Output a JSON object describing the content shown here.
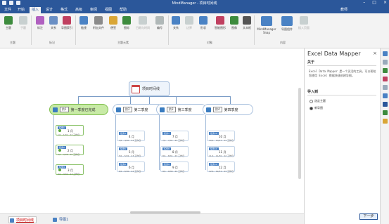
{
  "window": {
    "title": "MindManager - 项目时间线",
    "account": "教师",
    "controls": [
      "–",
      "□",
      "×"
    ]
  },
  "menu": {
    "tabs": [
      "文件",
      "开始",
      "插入",
      "设计",
      "格式",
      "高级",
      "审阅",
      "视图",
      "帮助"
    ],
    "active_index": 2
  },
  "ribbon": {
    "buttons": [
      {
        "label": "主题",
        "icon": "topic-icon",
        "color": "#3d8b3d"
      },
      {
        "label": "子题",
        "icon": "subtopic-icon",
        "color": "#9aa",
        "dim": true
      },
      {
        "label": "标注",
        "icon": "callout-icon",
        "color": "#b060c0"
      },
      {
        "label": "关系",
        "icon": "relationship-icon",
        "color": "#6a8fc4"
      },
      {
        "label": "导图索引",
        "icon": "index-icon",
        "color": "#c04060"
      },
      {
        "label": "链接",
        "icon": "link-icon",
        "color": "#4a82c4"
      },
      {
        "label": "附加文件",
        "icon": "attach-icon",
        "color": "#8a8a8a"
      },
      {
        "label": "便签",
        "icon": "notes-icon",
        "color": "#d9a636"
      },
      {
        "label": "图标",
        "icon": "icons-icon",
        "color": "#3d8b3d"
      },
      {
        "label": "日期与时间",
        "icon": "date-icon",
        "color": "#9aa",
        "dim": true
      },
      {
        "label": "编号",
        "icon": "numbering-icon",
        "color": "#9aa"
      },
      {
        "label": "关系",
        "icon": "boundary-icon",
        "color": "#4a82c4"
      },
      {
        "label": "边界",
        "icon": "border-icon",
        "color": "#9aa",
        "dim": true
      },
      {
        "label": "形状",
        "icon": "shape-icon",
        "color": "#4a82c4"
      },
      {
        "label": "智能图形",
        "icon": "smartshape-icon",
        "color": "#c04060"
      },
      {
        "label": "图像",
        "icon": "image-icon",
        "color": "#3d8b3d"
      },
      {
        "label": "文本框",
        "icon": "textbox-icon",
        "color": "#555"
      },
      {
        "label": "MindManager Snap",
        "icon": "snap-icon",
        "color": "#4a82c4"
      },
      {
        "label": "导图组件",
        "icon": "component-icon",
        "color": "#4a82c4"
      },
      {
        "label": "插入页面",
        "icon": "page-icon",
        "color": "#9aa",
        "dim": true
      }
    ],
    "groups": [
      "主题",
      "标记",
      "主题元素",
      "对象",
      "内容"
    ]
  },
  "map": {
    "central": "项目时间线",
    "quarters": [
      {
        "tag": "阶1",
        "name": "第一季度已完成",
        "tasks": [
          {
            "label": "任务1",
            "month": "1 月",
            "dates": "1/1 - 1/31 · 22 工作日"
          },
          {
            "label": "任务2",
            "month": "2 月",
            "dates": "2/1 - 2/28 · 20 工作日"
          },
          {
            "label": "任务3",
            "month": "3 月",
            "dates": "3/1 - 3/31 · 23 工作日"
          }
        ]
      },
      {
        "tag": "阶2",
        "name": "第二季度",
        "tasks": [
          {
            "label": "任务4",
            "month": "4 月",
            "dates": "4/1 - 4/30 · 22 工作日"
          },
          {
            "label": "任务5",
            "month": "5 月",
            "dates": "5/1 - 5/31 · 23 工作日"
          },
          {
            "label": "任务6",
            "month": "6 月",
            "dates": "6/1 - 6/30 · 22 工作日"
          }
        ]
      },
      {
        "tag": "阶3",
        "name": "第三季度",
        "tasks": [
          {
            "label": "任务7",
            "month": "7 月",
            "dates": "7/1 - 7/31 · 23 工作日"
          },
          {
            "label": "任务8",
            "month": "8 月",
            "dates": "8/1 - 8/31 · 23 工作日"
          },
          {
            "label": "任务9",
            "month": "9 月",
            "dates": "9/1 - 9/30 · 22 工作日"
          }
        ]
      },
      {
        "tag": "阶4",
        "name": "第四季度",
        "tasks": [
          {
            "label": "任务10",
            "month": "10 月",
            "dates": "10/1 - 10/31 · 23 工作日"
          },
          {
            "label": "任务11",
            "month": "11 月",
            "dates": "11/1 - 11/30 · 22 工作日"
          },
          {
            "label": "任务12",
            "month": "12 月",
            "dates": "12/1 - 12/31 · 23 工作日"
          }
        ]
      }
    ]
  },
  "doc_tabs": [
    {
      "label": "项目时间线",
      "active": true
    },
    {
      "label": "导图1",
      "active": false
    }
  ],
  "taskpane": {
    "title": "Excel Data Mapper",
    "close": "×",
    "about_heading": "关于",
    "about_text": "Excel Data Mapper 是一个灵活的工具，可以帮助您使用 Excel 数据快速创建导图。",
    "import_heading": "导入到",
    "options": [
      "选定主题",
      "新导图"
    ],
    "selected_option": 1,
    "next_button": "下一步"
  },
  "colors": {
    "brand": "#2b579a",
    "completed_quarter": "#c8eaa6"
  }
}
